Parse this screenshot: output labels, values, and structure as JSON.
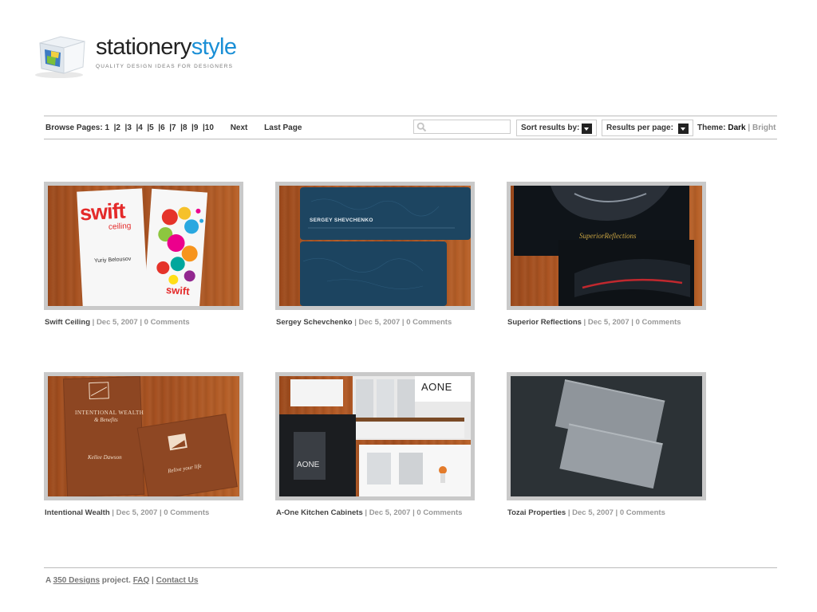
{
  "logo": {
    "title_main": "stationery",
    "title_accent": "style",
    "tagline": "QUALITY DESIGN IDEAS FOR DESIGNERS",
    "accent_color": "#1a8fd6"
  },
  "toolbar": {
    "browse_label": "Browse Pages:",
    "pages": [
      "1",
      "2",
      "3",
      "4",
      "5",
      "6",
      "7",
      "8",
      "9",
      "10"
    ],
    "next_label": "Next",
    "last_label": "Last Page",
    "search_value": "",
    "search_icon": "search-icon",
    "sort_label": "Sort results by:",
    "per_page_label": "Results per page:",
    "theme_label": "Theme:",
    "theme_dark": "Dark",
    "theme_bright": "Bright"
  },
  "gallery": [
    {
      "title": "Swift Ceiling",
      "date": "Dec 5, 2007",
      "comments": "0 Comments",
      "card_brand": "swift",
      "card_sub": "ceiling",
      "card_name": "Yuriy Belousov"
    },
    {
      "title": "Sergey Schevchenko",
      "date": "Dec 5, 2007",
      "comments": "0 Comments",
      "card_name": "SERGEY SHEVCHENKO"
    },
    {
      "title": "Superior Reflections",
      "date": "Dec 5, 2007",
      "comments": "0 Comments",
      "card_brand": "SuperiorReflections"
    },
    {
      "title": "Intentional Wealth",
      "date": "Dec 5, 2007",
      "comments": "0 Comments",
      "card_brand": "INTENTIONAL WEALTH",
      "card_sub": "& Benefits",
      "card_name": "Kellee Dawson",
      "card_slogan": "Relive your life"
    },
    {
      "title": "A-One Kitchen Cabinets",
      "date": "Dec 5, 2007",
      "comments": "0 Comments",
      "card_brand": "AONE"
    },
    {
      "title": "Tozai Properties",
      "date": "Dec 5, 2007",
      "comments": "0 Comments"
    }
  ],
  "footer": {
    "prefix": "A",
    "link_350": "350 Designs",
    "suffix": "project.",
    "faq": "FAQ",
    "contact": "Contact Us"
  }
}
